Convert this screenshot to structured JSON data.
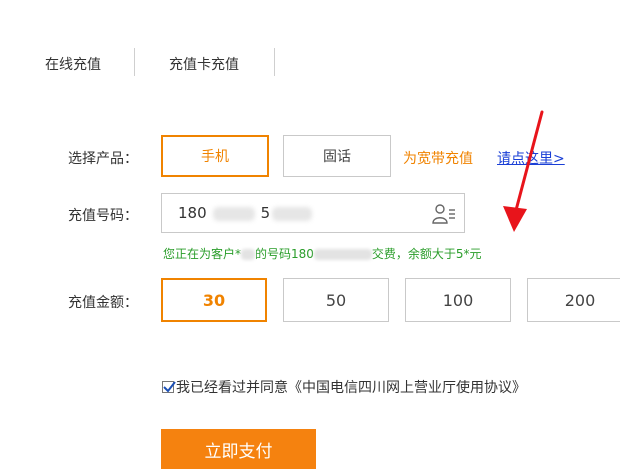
{
  "tabs": [
    {
      "label": "在线充值"
    },
    {
      "label": "充值卡充值"
    }
  ],
  "product": {
    "label": "选择产品：",
    "options": [
      "手机",
      "固话"
    ],
    "selected": "手机",
    "promo_text": "为宽带充值",
    "promo_link": "请点这里>"
  },
  "phone": {
    "label": "充值号码：",
    "value_prefix": "180",
    "value_mid": "5"
  },
  "hint": {
    "part1": "您正在为客户*",
    "part2": "的号码180",
    "part3": "交费，余额大于5*元"
  },
  "amount": {
    "label": "充值金额：",
    "options": [
      "30",
      "50",
      "100",
      "200"
    ],
    "selected": "30"
  },
  "agreement": {
    "checked": true,
    "prefix": "我已经看过并同意",
    "link": "《中国电信四川网上营业厅使用协议》"
  },
  "pay_button": "立即支付",
  "colors": {
    "accent": "#f08300",
    "link": "#1a3fd6",
    "hint": "#2a9d2a",
    "annotation_arrow": "#e8141b"
  },
  "icons": [
    "contact-book-icon",
    "checkbox-checked-icon",
    "red-arrow-annotation"
  ]
}
